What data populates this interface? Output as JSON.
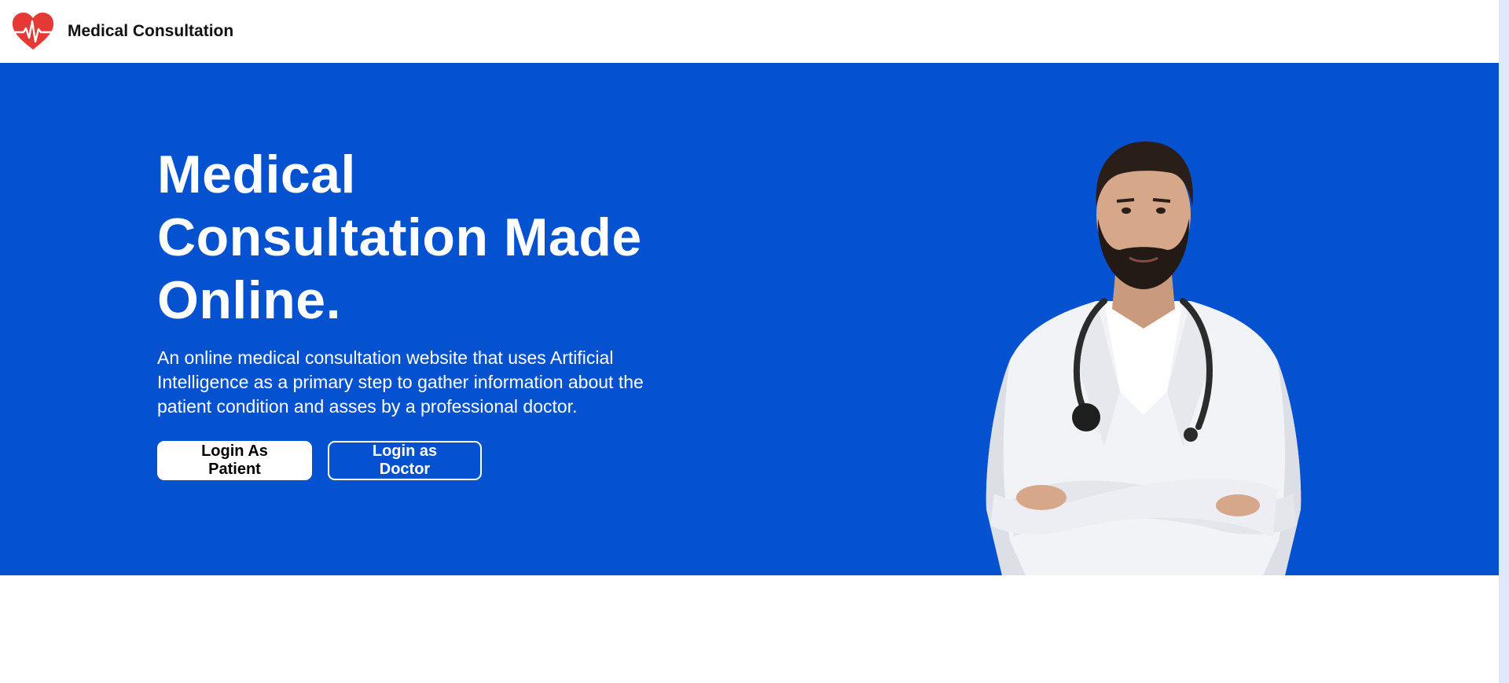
{
  "header": {
    "brand_name": "Medical Consultation",
    "logo_icon": "heart-pulse-icon"
  },
  "hero": {
    "title_lines": [
      "Medical",
      "Consultation Made",
      "Online."
    ],
    "description": "An online medical consultation website that uses Artificial Intelligence as a primary step to gather information about the patient condition and asses by a professional doctor.",
    "buttons": {
      "patient_label": "Login As Patient",
      "doctor_label": "Login as Doctor"
    },
    "image": "doctor-portrait"
  },
  "colors": {
    "hero_background": "#0452d0",
    "logo_heart": "#e53935",
    "text_primary": "#111111",
    "scrollbar_track": "#dfe9fb"
  }
}
